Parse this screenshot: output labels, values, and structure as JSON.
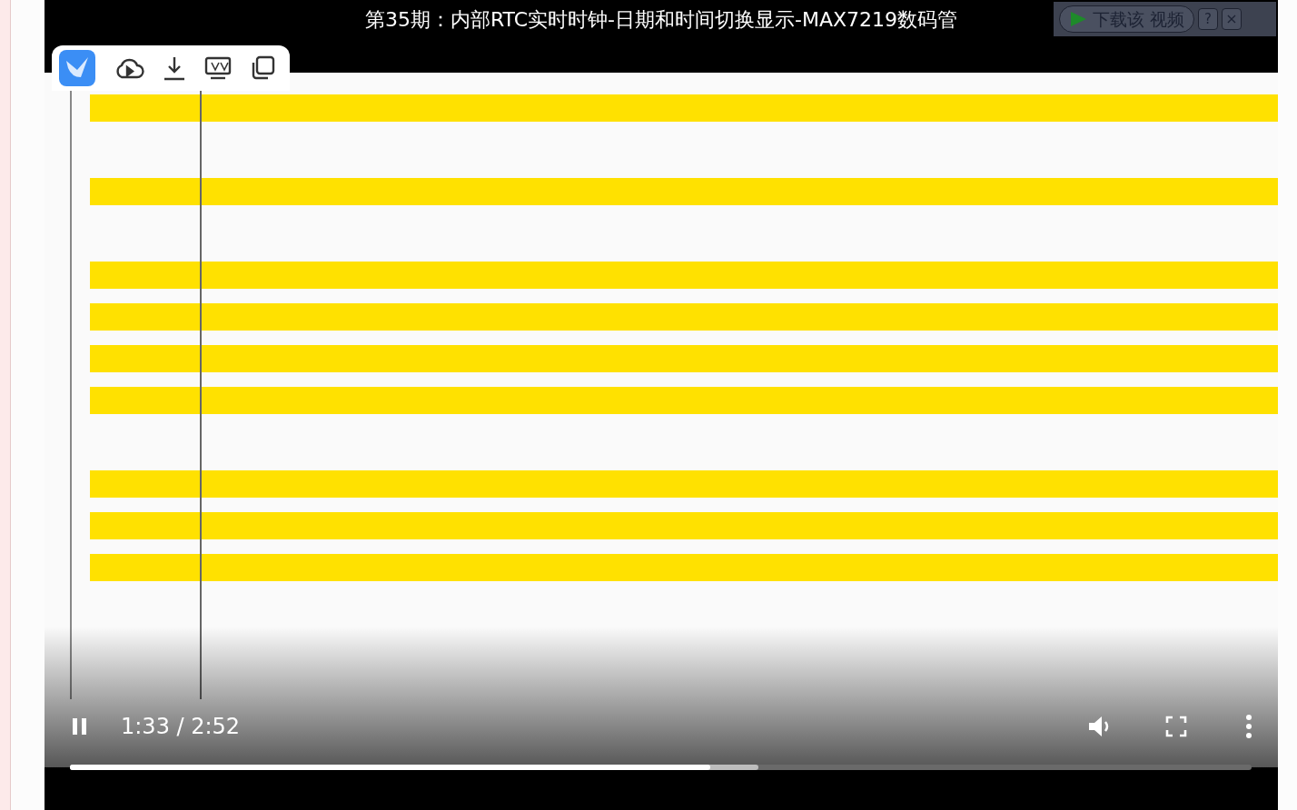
{
  "video": {
    "title": "第35期：内部RTC实时时钟-日期和时间切换显示-MAX7219数码管",
    "time": "1:33 / 2:52",
    "playing": true,
    "progress": {
      "level": 0.542
    },
    "buffered": {
      "level": 0.583
    }
  },
  "download_bar": {
    "label": "下载该 视频",
    "help": "?",
    "close": "×"
  }
}
